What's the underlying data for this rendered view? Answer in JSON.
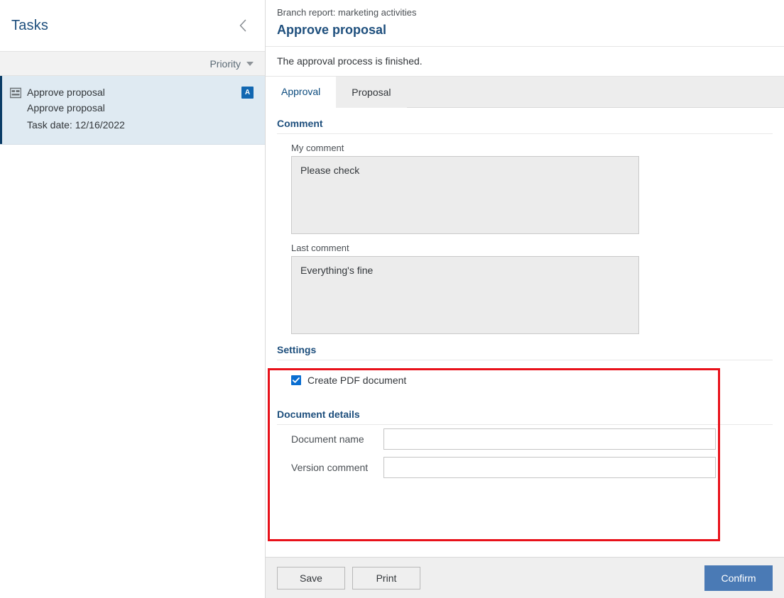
{
  "sidebar": {
    "title": "Tasks",
    "collapse_icon": "chevron-left-icon",
    "sort": {
      "label": "Priority",
      "caret_icon": "caret-down-icon"
    },
    "tasks": [
      {
        "icon": "form-icon",
        "title": "Approve proposal",
        "subtitle": "Approve proposal",
        "date_line": "Task date: 12/16/2022",
        "badge": "A"
      }
    ]
  },
  "main": {
    "breadcrumb": "Branch report: marketing activities",
    "title": "Approve proposal",
    "status": "The approval process is finished.",
    "tabs": [
      {
        "label": "Approval",
        "active": true
      },
      {
        "label": "Proposal",
        "active": false
      }
    ],
    "comment_section": {
      "heading": "Comment",
      "my_comment": {
        "label": "My comment",
        "value": "Please check"
      },
      "last_comment": {
        "label": "Last comment",
        "value": "Everything's fine"
      }
    },
    "settings_section": {
      "heading": "Settings",
      "create_pdf": {
        "label": "Create PDF document",
        "checked": true,
        "icon": "checkmark-icon"
      },
      "document_details": {
        "heading": "Document details",
        "fields": [
          {
            "label": "Document name",
            "value": "",
            "placeholder": ""
          },
          {
            "label": "Version comment",
            "value": "",
            "placeholder": ""
          }
        ]
      }
    }
  },
  "footer": {
    "save_label": "Save",
    "print_label": "Print",
    "confirm_label": "Confirm"
  },
  "colors": {
    "accent_blue": "#1e4f7d",
    "badge_blue": "#1267b1",
    "checkbox_blue": "#0a6ed1",
    "primary_button": "#4a7ab5",
    "highlight_red": "#e8111a",
    "selected_row": "#dfeaf2"
  }
}
